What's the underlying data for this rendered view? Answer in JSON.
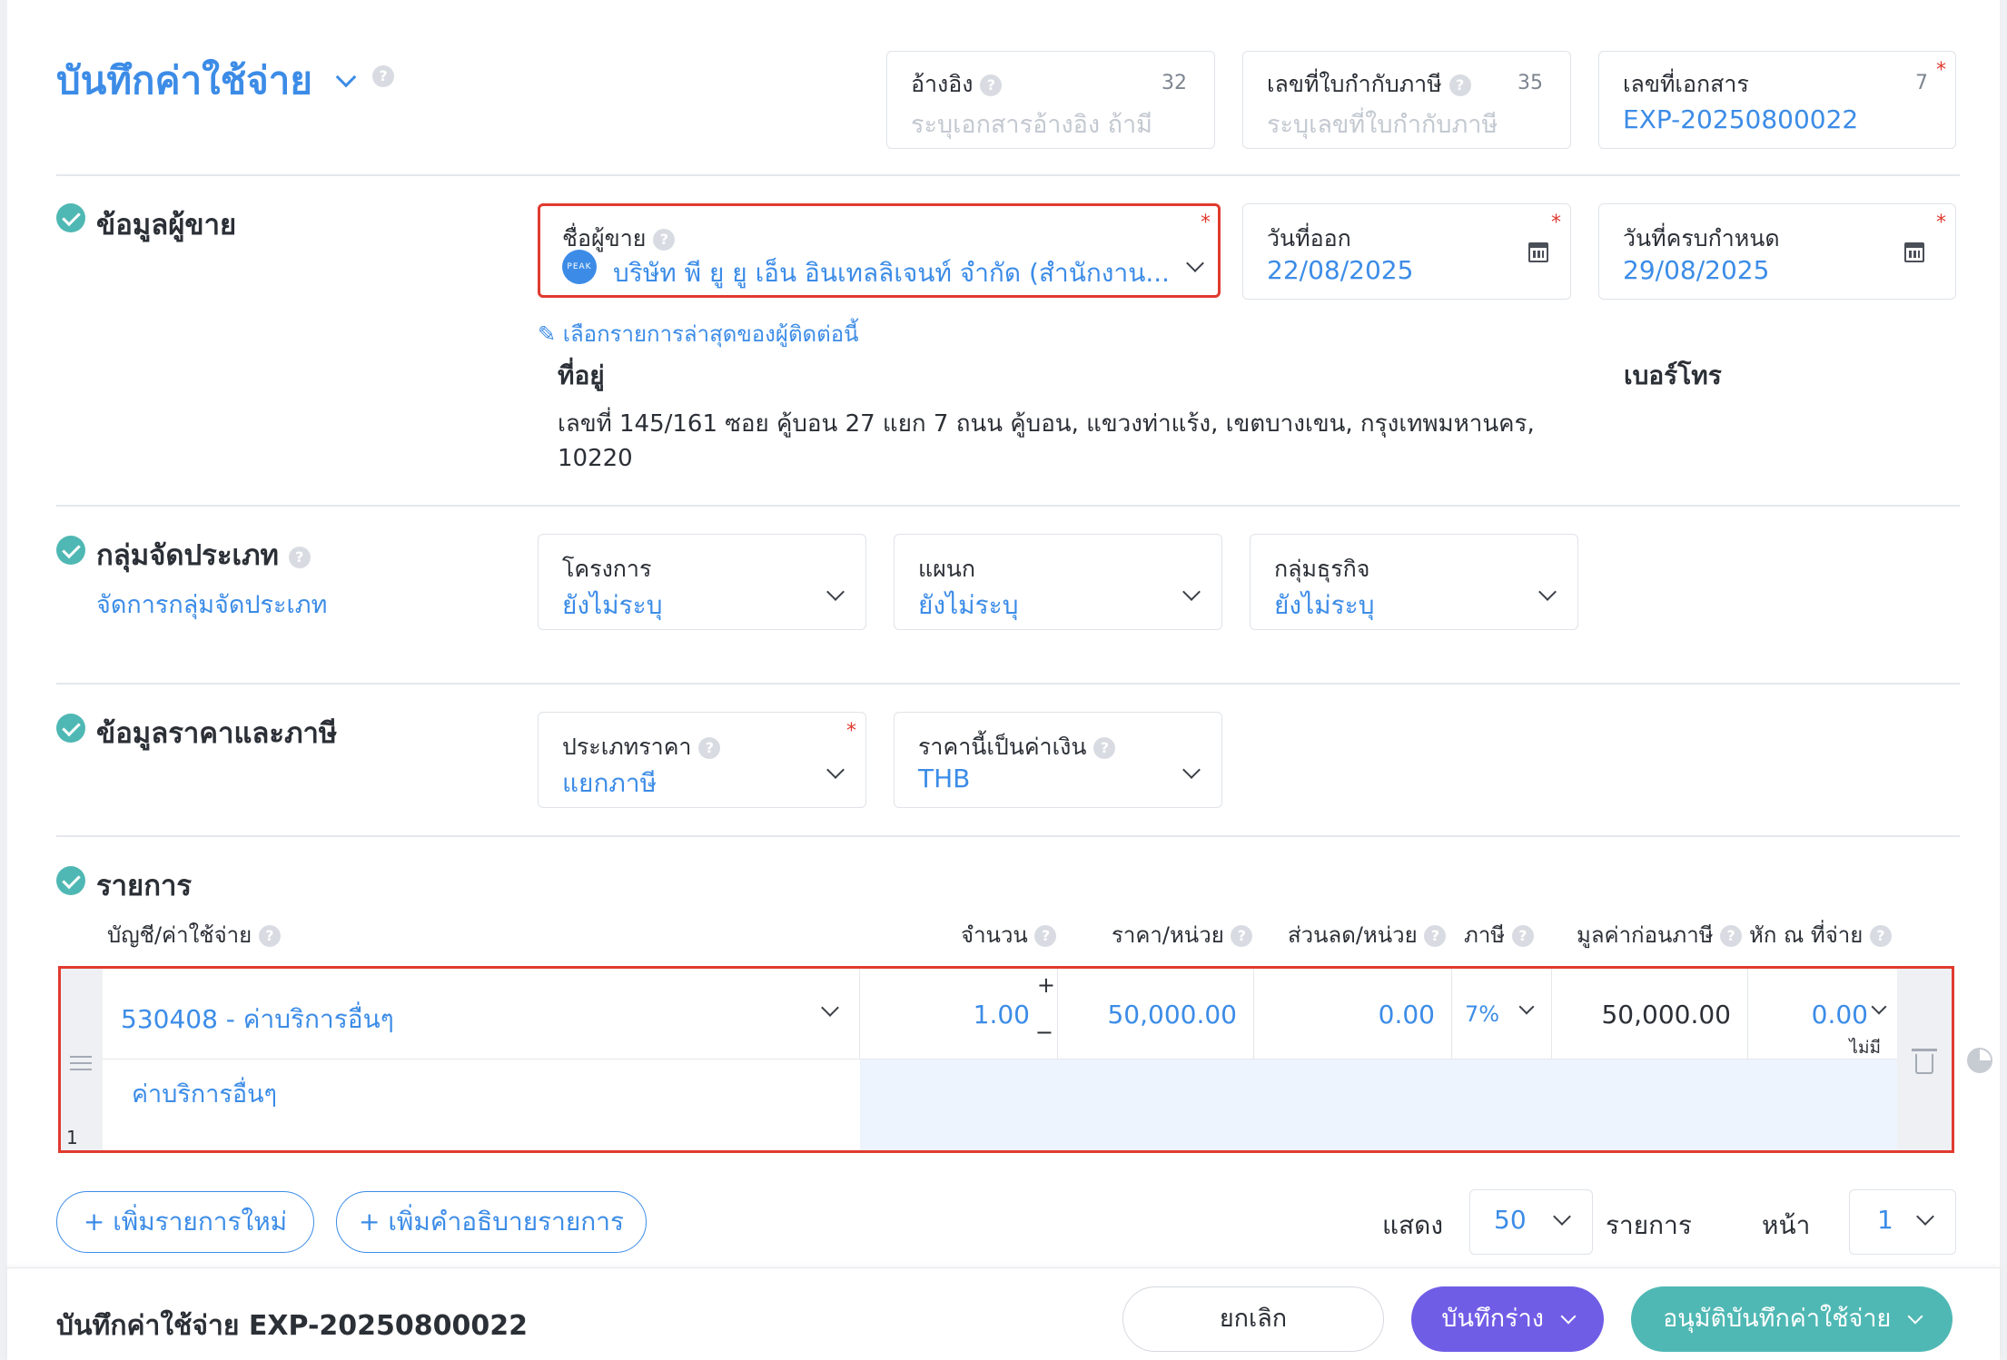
{
  "header": {
    "title": "บันทึกค่าใช้จ่าย",
    "reference": {
      "label": "อ้างอิง",
      "counter": "32",
      "placeholder": "ระบุเอกสารอ้างอิง ถ้ามี"
    },
    "tax_invoice": {
      "label": "เลขที่ใบกำกับภาษี",
      "counter": "35",
      "placeholder": "ระบุเลขที่ใบกำกับภาษี"
    },
    "doc_no": {
      "label": "เลขที่เอกสาร",
      "counter": "7",
      "value": "EXP-20250800022"
    }
  },
  "vendor": {
    "section_title": "ข้อมูลผู้ขาย",
    "name_label": "ชื่อผู้ขาย",
    "name_value": "บริษัท พี ยู ยู เอ็น อินเทลลิเจนท์ จำกัด (สำนักงาน...",
    "logo_text": "PEAK",
    "issue_date_label": "วันที่ออก",
    "issue_date": "22/08/2025",
    "due_date_label": "วันที่ครบกำหนด",
    "due_date": "29/08/2025",
    "recent_link": "เลือกรายการล่าสุดของผู้ติดต่อนี้",
    "address_label": "ที่อยู่",
    "address_line1": "เลขที่ 145/161 ซอย คู้บอน 27 แยก 7 ถนน คู้บอน, แขวงท่าแร้ง, เขตบางเขน, กรุงเทพมหานคร,",
    "address_line2": "10220",
    "phone_label": "เบอร์โทร"
  },
  "classification": {
    "section_title": "กลุ่มจัดประเภท",
    "manage_link": "จัดการกลุ่มจัดประเภท",
    "project": {
      "label": "โครงการ",
      "value": "ยังไม่ระบุ"
    },
    "department": {
      "label": "แผนก",
      "value": "ยังไม่ระบุ"
    },
    "business_group": {
      "label": "กลุ่มธุรกิจ",
      "value": "ยังไม่ระบุ"
    }
  },
  "pricing": {
    "section_title": "ข้อมูลราคาและภาษี",
    "price_type": {
      "label": "ประเภทราคา",
      "value": "แยกภาษี"
    },
    "currency": {
      "label": "ราคานี้เป็นค่าเงิน",
      "value": "THB"
    }
  },
  "items": {
    "section_title": "รายการ",
    "columns": {
      "account": "บัญชี/ค่าใช้จ่าย",
      "qty": "จำนวน",
      "price": "ราคา/หน่วย",
      "discount": "ส่วนลด/หน่วย",
      "tax": "ภาษี",
      "pretax": "มูลค่าก่อนภาษี",
      "wht": "หัก ณ ที่จ่าย"
    },
    "rows": [
      {
        "index": "1",
        "account": "530408 - ค่าบริการอื่นๆ",
        "description": "ค่าบริการอื่นๆ",
        "qty": "1.00",
        "price": "50,000.00",
        "discount": "0.00",
        "tax": "7%",
        "pretax": "50,000.00",
        "wht": "0.00",
        "wht_note": "ไม่มี"
      }
    ],
    "add_item": "+ เพิ่มรายการใหม่",
    "add_desc": "+ เพิ่มคำอธิบายรายการ",
    "show_label": "แสดง",
    "page_size": "50",
    "items_label": "รายการ",
    "page_label": "หน้า",
    "page": "1"
  },
  "footer": {
    "doc_title": "บันทึกค่าใช้จ่าย EXP-20250800022",
    "cancel": "ยกเลิก",
    "draft": "บันทึกร่าง",
    "approve": "อนุมัติบันทึกค่าใช้จ่าย"
  },
  "colors": {
    "accent": "#3c8ce7",
    "check": "#4fb8b4",
    "highlight": "#e03a2f",
    "draft_btn": "#6f5de6",
    "approve_btn": "#4fb8b4"
  }
}
